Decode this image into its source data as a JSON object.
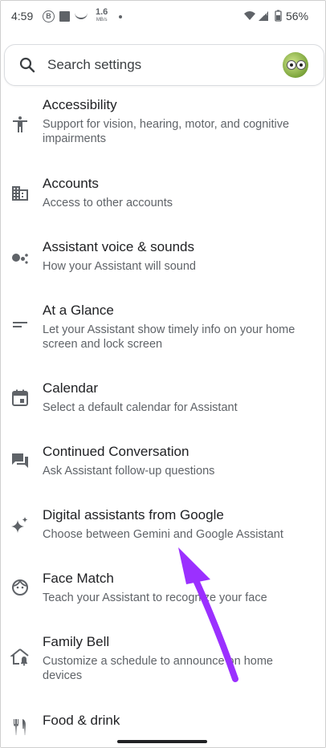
{
  "status_bar": {
    "time": "4:59",
    "b_badge": "B",
    "speed_value": "1.6",
    "speed_unit": "MB/s",
    "battery": "56%"
  },
  "search": {
    "placeholder": "Search settings"
  },
  "items": [
    {
      "title": "Accessibility",
      "subtitle": "Support for vision, hearing, motor, and cognitive impairments",
      "icon": "accessibility-icon"
    },
    {
      "title": "Accounts",
      "subtitle": "Access to other accounts",
      "icon": "building-icon"
    },
    {
      "title": "Assistant voice & sounds",
      "subtitle": "How your Assistant will sound",
      "icon": "assistant-dots-icon"
    },
    {
      "title": "At a Glance",
      "subtitle": "Let your Assistant show timely info on your home screen and lock screen",
      "icon": "glance-lines-icon"
    },
    {
      "title": "Calendar",
      "subtitle": "Select a default calendar for Assistant",
      "icon": "calendar-icon"
    },
    {
      "title": "Continued Conversation",
      "subtitle": "Ask Assistant follow-up questions",
      "icon": "chat-bubbles-icon"
    },
    {
      "title": "Digital assistants from Google",
      "subtitle": "Choose between Gemini and Google Assistant",
      "icon": "sparkle-icon"
    },
    {
      "title": "Face Match",
      "subtitle": "Teach your Assistant to recognize your face",
      "icon": "face-icon"
    },
    {
      "title": "Family Bell",
      "subtitle": "Customize a schedule to announce on home devices",
      "icon": "home-bell-icon"
    },
    {
      "title": "Food & drink",
      "subtitle": "",
      "icon": "fork-knife-icon"
    }
  ],
  "colors": {
    "annotation_arrow": "#9b30ff",
    "icon": "#5f6368"
  }
}
